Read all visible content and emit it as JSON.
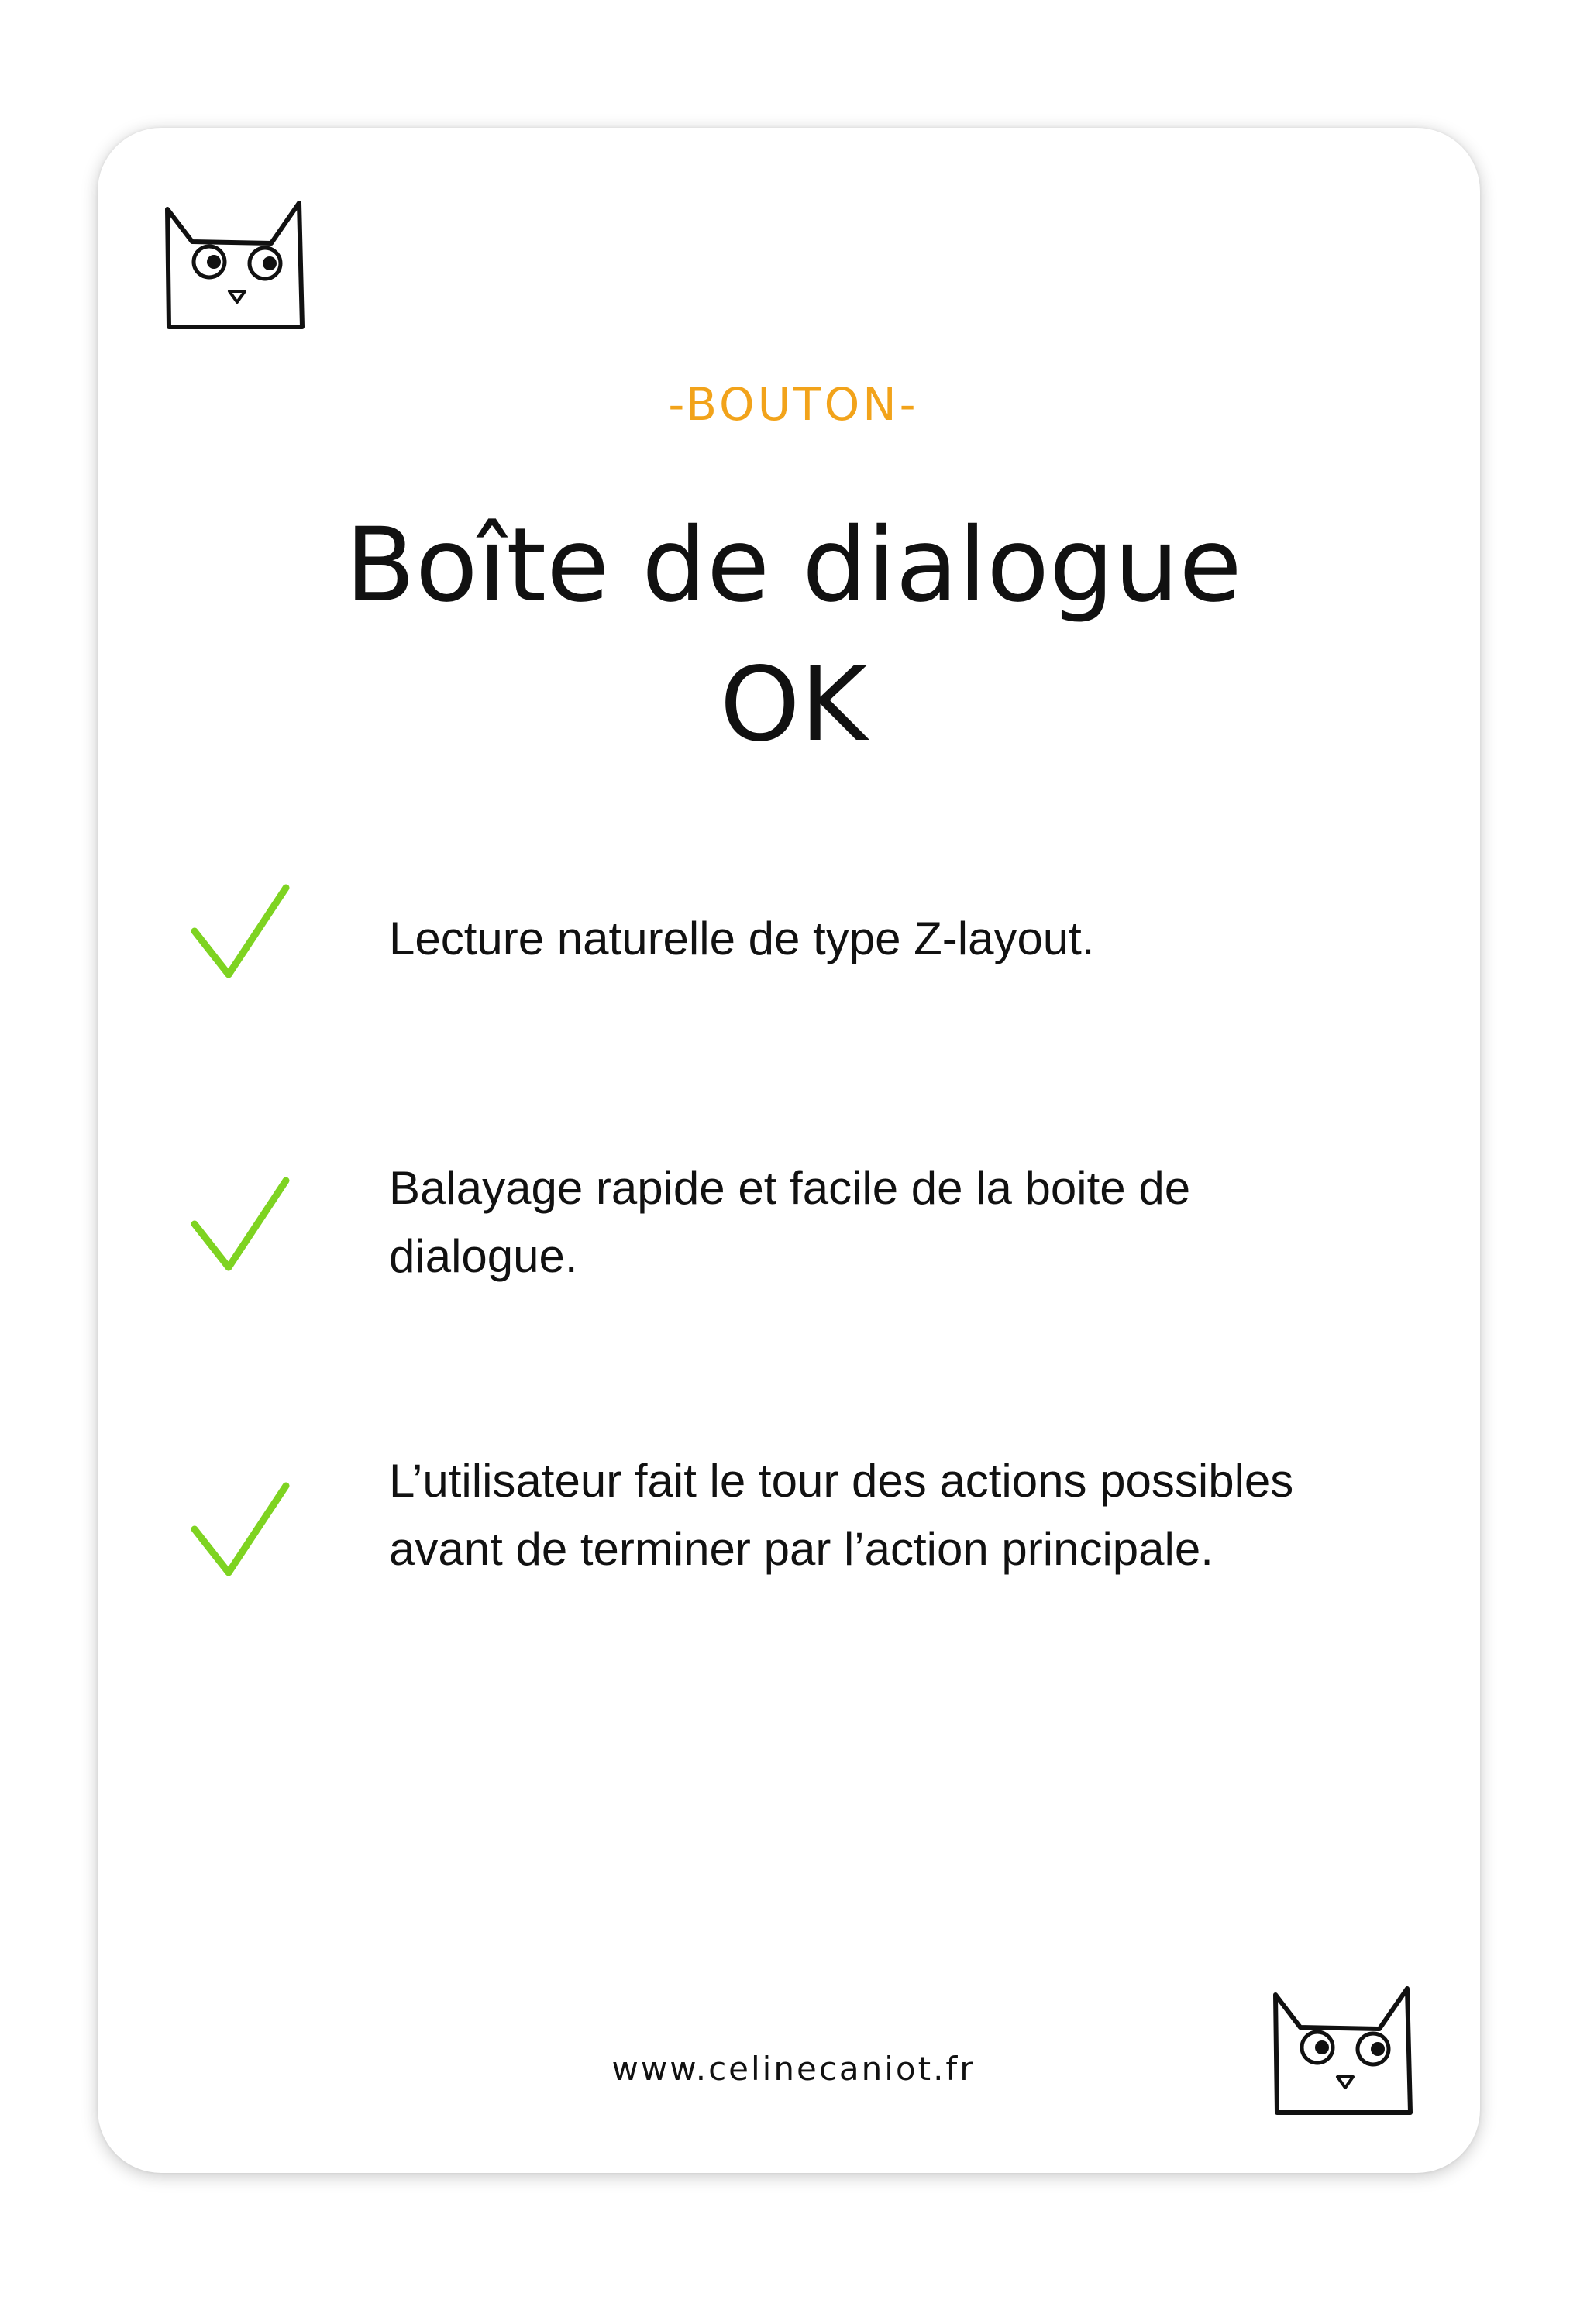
{
  "category": "-BOUTON-",
  "title": {
    "line1": "Boîte de dialogue",
    "line2": "OK"
  },
  "items": [
    {
      "icon": "check-icon",
      "text": "Lecture naturelle de type Z-layout."
    },
    {
      "icon": "check-icon",
      "text": "Balayage rapide et facile de la boite de dialogue."
    },
    {
      "icon": "check-icon",
      "text": "L’utilisateur fait le tour des actions possibles avant de terminer par l’action principale."
    }
  ],
  "footer": {
    "website": "www.celinecaniot.fr"
  },
  "colors": {
    "accent": "#f2a31a",
    "check": "#7ed321",
    "text": "#111111"
  },
  "decorations": [
    "owl-mascot-icon",
    "owl-mascot-icon"
  ]
}
